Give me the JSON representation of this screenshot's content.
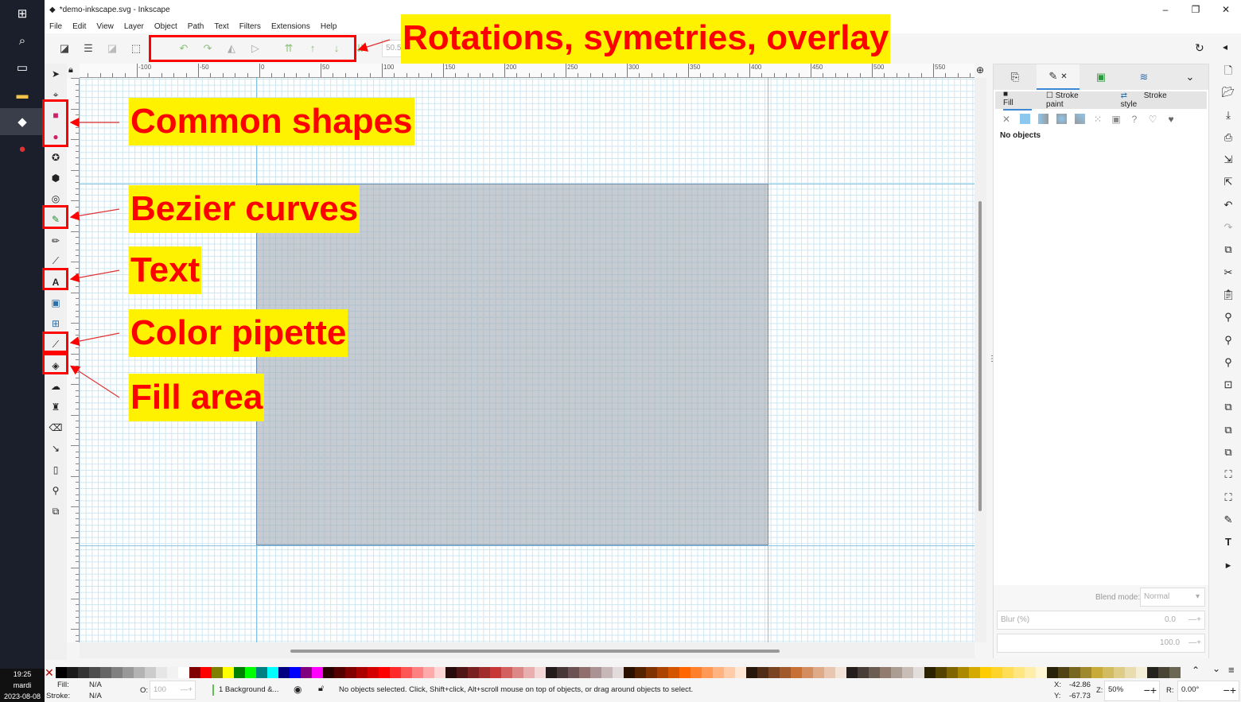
{
  "window": {
    "title": "*demo-inkscape.svg - Inkscape",
    "minimize": "–",
    "maximize": "❐",
    "close": "✕"
  },
  "taskbar": {
    "time": "19:25",
    "day": "mardi",
    "date": "2023-08-08"
  },
  "menu": [
    "File",
    "Edit",
    "View",
    "Layer",
    "Object",
    "Path",
    "Text",
    "Filters",
    "Extensions",
    "Help"
  ],
  "toolbar": {
    "value": "50.550"
  },
  "ruler": {
    "labels": [
      "-100",
      "-50",
      "0",
      "50",
      "100",
      "150",
      "200",
      "250",
      "300",
      "350",
      "400",
      "450",
      "500",
      "550"
    ]
  },
  "panel": {
    "tabs": [
      "fill-and-stroke",
      "fill-stroke-x",
      "export",
      "layers"
    ],
    "subtabs": [
      "Fill",
      "Stroke paint",
      "Stroke style"
    ],
    "message": "No objects",
    "blend_label": "Blend mode:",
    "blend_value": "Normal",
    "blur_label": "Blur (%)",
    "blur_value": "0.0",
    "opacity_value": "100.0"
  },
  "status": {
    "fill_label": "Fill:",
    "fill_value": "N/A",
    "stroke_label": "Stroke:",
    "stroke_value": "N/A",
    "opacity_label": "O:",
    "opacity_value": "100",
    "layer": "1 Background &...",
    "message": "No objects selected. Click, Shift+click, Alt+scroll mouse on top of objects, or drag around objects to select.",
    "x_label": "X:",
    "x_value": "-42.86",
    "y_label": "Y:",
    "y_value": "-67.73",
    "zoom_label": "Z:",
    "zoom_value": "50%",
    "rot_label": "R:",
    "rot_value": "0.00°"
  },
  "annotations": {
    "rotations": "Rotations, symetries, overlay",
    "shapes": "Common shapes",
    "bezier": "Bezier curves",
    "text": "Text",
    "pipette": "Color pipette",
    "fill": "Fill area"
  },
  "colors": {
    "annotation_text": "#ff0000",
    "annotation_bg": "#fff200",
    "accent": "#3b88d6"
  },
  "palette": [
    "#000000",
    "#1a1a1a",
    "#333333",
    "#4d4d4d",
    "#666666",
    "#808080",
    "#999999",
    "#b3b3b3",
    "#cccccc",
    "#e6e6e6",
    "#f2f2f2",
    "#ffffff",
    "#800000",
    "#ff0000",
    "#808000",
    "#ffff00",
    "#008000",
    "#00ff00",
    "#008080",
    "#00ffff",
    "#000080",
    "#0000ff",
    "#800080",
    "#ff00ff",
    "#2b0000",
    "#550000",
    "#800000",
    "#aa0000",
    "#d40000",
    "#ff0000",
    "#ff2a2a",
    "#ff5555",
    "#ff8080",
    "#ffaaaa",
    "#ffd5d5",
    "#280b0b",
    "#501616",
    "#782121",
    "#a02c2c",
    "#c83737",
    "#d35f5f",
    "#de8787",
    "#e9afaf",
    "#f4d7d7",
    "#241c1c",
    "#483737",
    "#6c5353",
    "#916f6f",
    "#ac9393",
    "#c8b7b7",
    "#e3dbdb",
    "#2b1100",
    "#552200",
    "#803300",
    "#aa4400",
    "#d45500",
    "#ff6600",
    "#ff7f2a",
    "#ff9955",
    "#ffb380",
    "#ffccaa",
    "#ffe6d5",
    "#28170b",
    "#502d16",
    "#784421",
    "#a05a2c",
    "#c87137",
    "#d38d5f",
    "#deaa87",
    "#e9c6af",
    "#f4e3d7",
    "#241f1c",
    "#483e37",
    "#6c5d53",
    "#917c6f",
    "#ac9d93",
    "#c8beb7",
    "#e3dedb",
    "#2b2200",
    "#554400",
    "#806600",
    "#aa8800",
    "#d4aa00",
    "#ffcc00",
    "#ffd42a",
    "#ffdd55",
    "#ffe680",
    "#ffeeaa",
    "#fff6d5",
    "#28220b",
    "#504416",
    "#786721",
    "#a0892c",
    "#c8ab37",
    "#d3bc5f",
    "#decd87",
    "#e9ddaf",
    "#f4eed7",
    "#24221c",
    "#484537",
    "#6c6753"
  ]
}
